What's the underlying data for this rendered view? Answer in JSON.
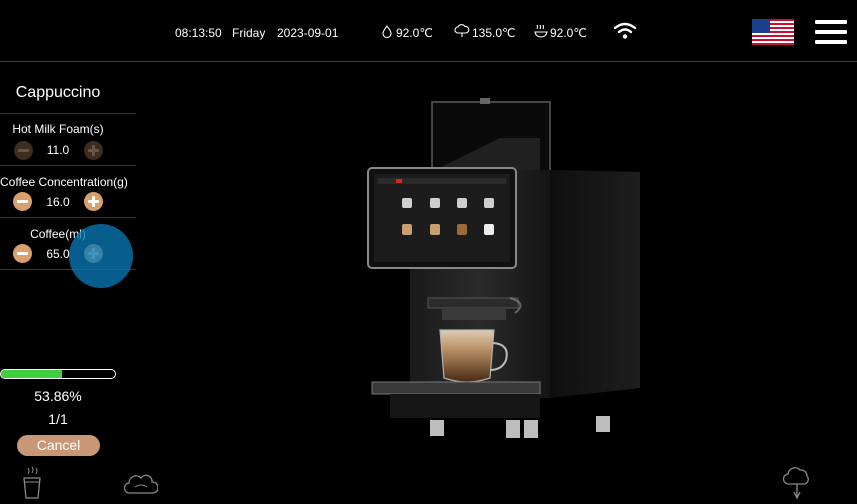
{
  "status_bar": {
    "time": "08:13:50",
    "weekday": "Friday",
    "date": "2023-09-01",
    "water_temp": "92.0℃",
    "steam_temp": "135.0℃",
    "brew_temp": "92.0℃",
    "wifi_icon": "wifi-icon",
    "language_flag": "us-flag-icon",
    "menu_icon": "hamburger-menu-icon"
  },
  "drink": {
    "name": "Cappuccino",
    "params": [
      {
        "label": "Hot Milk Foam(s)",
        "value": "11.0",
        "enabled": false
      },
      {
        "label": "Coffee Concentration(g)",
        "value": "16.0",
        "enabled": true
      },
      {
        "label": "Coffee(ml)",
        "value": "65.0",
        "enabled": true
      }
    ]
  },
  "progress": {
    "fraction": 0.5386,
    "percent_text": "53.86%",
    "count_text": "1/1",
    "cancel_label": "Cancel"
  },
  "bottom_icons": [
    "hot-drink-cup-icon",
    "milk-cloud-icon",
    "steam-tap-icon"
  ],
  "colors": {
    "accent": "#d9a06e",
    "accent_disabled": "#3d2c20",
    "progress": "#3fcf3f",
    "cancel": "#c99676",
    "touch_indicator": "#0978b4"
  }
}
